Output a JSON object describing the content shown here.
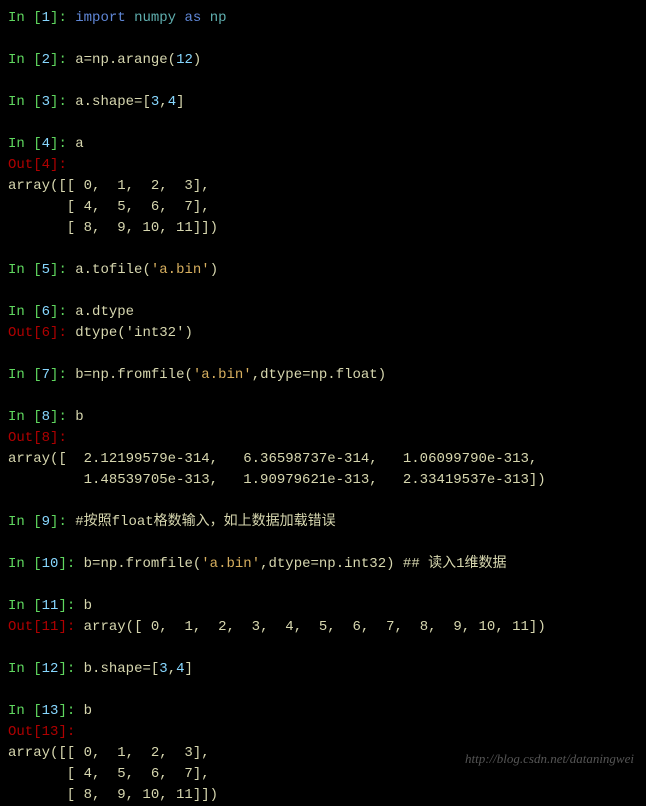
{
  "cells": [
    {
      "type": "in",
      "n": "1",
      "segments": [
        {
          "cls": "kw",
          "t": "import"
        },
        {
          "cls": "code",
          "t": " "
        },
        {
          "cls": "mod",
          "t": "numpy"
        },
        {
          "cls": "code",
          "t": " "
        },
        {
          "cls": "kw",
          "t": "as"
        },
        {
          "cls": "code",
          "t": " "
        },
        {
          "cls": "mod",
          "t": "np"
        }
      ]
    },
    {
      "type": "blank"
    },
    {
      "type": "in",
      "n": "2",
      "segments": [
        {
          "cls": "code",
          "t": "a=np.arange("
        },
        {
          "cls": "lit",
          "t": "12"
        },
        {
          "cls": "code",
          "t": ")"
        }
      ]
    },
    {
      "type": "blank"
    },
    {
      "type": "in",
      "n": "3",
      "segments": [
        {
          "cls": "code",
          "t": "a.shape=["
        },
        {
          "cls": "lit",
          "t": "3"
        },
        {
          "cls": "code",
          "t": ","
        },
        {
          "cls": "lit",
          "t": "4"
        },
        {
          "cls": "code",
          "t": "]"
        }
      ]
    },
    {
      "type": "blank"
    },
    {
      "type": "in",
      "n": "4",
      "segments": [
        {
          "cls": "code",
          "t": "a"
        }
      ]
    },
    {
      "type": "out",
      "n": "4",
      "segments": []
    },
    {
      "type": "plain",
      "text": "array([[ 0,  1,  2,  3],"
    },
    {
      "type": "plain",
      "text": "       [ 4,  5,  6,  7],"
    },
    {
      "type": "plain",
      "text": "       [ 8,  9, 10, 11]])"
    },
    {
      "type": "blank"
    },
    {
      "type": "in",
      "n": "5",
      "segments": [
        {
          "cls": "code",
          "t": "a.tofile("
        },
        {
          "cls": "str",
          "t": "'a.bin'"
        },
        {
          "cls": "code",
          "t": ")"
        }
      ]
    },
    {
      "type": "blank"
    },
    {
      "type": "in",
      "n": "6",
      "segments": [
        {
          "cls": "code",
          "t": "a.dtype"
        }
      ]
    },
    {
      "type": "out",
      "n": "6",
      "segments": [
        {
          "cls": "out-text",
          "t": "dtype('int32')"
        }
      ]
    },
    {
      "type": "blank"
    },
    {
      "type": "in",
      "n": "7",
      "segments": [
        {
          "cls": "code",
          "t": "b=np.fromfile("
        },
        {
          "cls": "str",
          "t": "'a.bin'"
        },
        {
          "cls": "code",
          "t": ",dtype=np.float)"
        }
      ]
    },
    {
      "type": "blank"
    },
    {
      "type": "in",
      "n": "8",
      "segments": [
        {
          "cls": "code",
          "t": "b"
        }
      ]
    },
    {
      "type": "out",
      "n": "8",
      "segments": []
    },
    {
      "type": "plain",
      "text": "array([  2.12199579e-314,   6.36598737e-314,   1.06099790e-313,"
    },
    {
      "type": "plain",
      "text": "         1.48539705e-313,   1.90979621e-313,   2.33419537e-313])"
    },
    {
      "type": "blank"
    },
    {
      "type": "in",
      "n": "9",
      "segments": [
        {
          "cls": "comment",
          "t": "#按照float格数输入，如上数据加载错误"
        }
      ]
    },
    {
      "type": "blank"
    },
    {
      "type": "in",
      "n": "10",
      "segments": [
        {
          "cls": "code",
          "t": "b=np.fromfile("
        },
        {
          "cls": "str",
          "t": "'a.bin'"
        },
        {
          "cls": "code",
          "t": ",dtype=np.int32) "
        },
        {
          "cls": "comment",
          "t": "## 读入1维数据"
        }
      ]
    },
    {
      "type": "blank"
    },
    {
      "type": "in",
      "n": "11",
      "segments": [
        {
          "cls": "code",
          "t": "b"
        }
      ]
    },
    {
      "type": "out",
      "n": "11",
      "segments": [
        {
          "cls": "out-text",
          "t": "array([ 0,  1,  2,  3,  4,  5,  6,  7,  8,  9, 10, 11])"
        }
      ]
    },
    {
      "type": "blank"
    },
    {
      "type": "in",
      "n": "12",
      "segments": [
        {
          "cls": "code",
          "t": "b.shape=["
        },
        {
          "cls": "lit",
          "t": "3"
        },
        {
          "cls": "code",
          "t": ","
        },
        {
          "cls": "lit",
          "t": "4"
        },
        {
          "cls": "code",
          "t": "]"
        }
      ]
    },
    {
      "type": "blank"
    },
    {
      "type": "in",
      "n": "13",
      "segments": [
        {
          "cls": "code",
          "t": "b"
        }
      ]
    },
    {
      "type": "out",
      "n": "13",
      "segments": []
    },
    {
      "type": "plain",
      "text": "array([[ 0,  1,  2,  3],"
    },
    {
      "type": "plain",
      "text": "       [ 4,  5,  6,  7],"
    },
    {
      "type": "plain",
      "text": "       [ 8,  9, 10, 11]])"
    }
  ],
  "watermark": "http://blog.csdn.net/dataningwei",
  "labels": {
    "in": "In ",
    "out": "Out"
  }
}
